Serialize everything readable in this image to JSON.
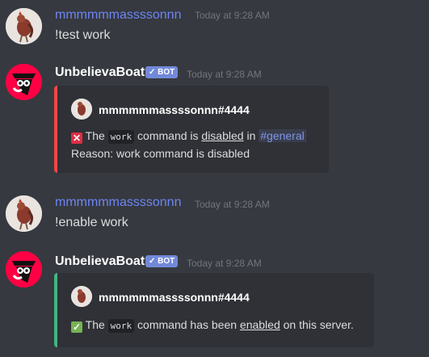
{
  "messages": [
    {
      "username": "mmmmmmassssonnn",
      "timestamp": "Today at 9:28 AM",
      "text": "!test work"
    },
    {
      "username": "UnbelievaBoat",
      "bot_tag": "✓ BOT",
      "timestamp": "Today at 9:28 AM",
      "embed": {
        "author": "mmmmmmassssonnn#4444",
        "icon": "cross-mark-icon",
        "icon_glyph": "✕",
        "line1": {
          "pre": "The",
          "code": "work",
          "mid": "command is",
          "status": "disabled",
          "in": "in",
          "channel": "#general"
        },
        "reason": "Reason: work command is disabled",
        "accent": "#f04747"
      }
    },
    {
      "username": "mmmmmmassssonnn",
      "timestamp": "Today at 9:28 AM",
      "text": "!enable work"
    },
    {
      "username": "UnbelievaBoat",
      "bot_tag": "✓ BOT",
      "timestamp": "Today at 9:28 AM",
      "embed": {
        "author": "mmmmmmassssonnn#4444",
        "icon": "check-mark-icon",
        "icon_glyph": "✓",
        "line1": {
          "pre": "The",
          "code": "work",
          "mid": "command has been",
          "status": "enabled",
          "post": "on this server."
        },
        "accent": "#43b581"
      }
    }
  ],
  "colors": {
    "background": "#36393f",
    "embed_bg": "#2f3136",
    "user_name": "#6e85f4",
    "bot_tag": "#7289da",
    "timestamp": "#72767d"
  }
}
